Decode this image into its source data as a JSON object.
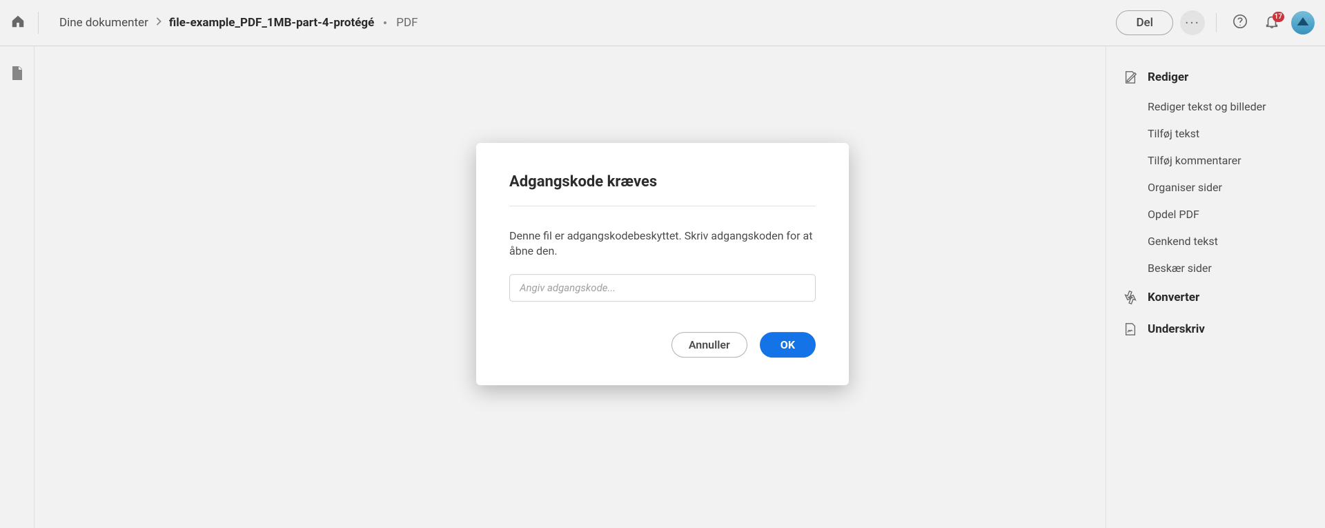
{
  "header": {
    "breadcrumb_root": "Dine dokumenter",
    "breadcrumb_file": "file-example_PDF_1MB-part-4-protégé",
    "file_type": "PDF",
    "share_label": "Del",
    "notification_count": "17"
  },
  "right_panel": {
    "edit": {
      "title": "Rediger",
      "items": [
        "Rediger tekst og billeder",
        "Tilføj tekst",
        "Tilføj kommentarer",
        "Organiser sider",
        "Opdel PDF",
        "Genkend tekst",
        "Beskær sider"
      ]
    },
    "convert": {
      "title": "Konverter"
    },
    "sign": {
      "title": "Underskriv"
    }
  },
  "modal": {
    "title": "Adgangskode kræves",
    "message": "Denne fil er adgangskodebeskyttet. Skriv adgangskoden for at åbne den.",
    "placeholder": "Angiv adgangskode...",
    "cancel_label": "Annuller",
    "ok_label": "OK"
  }
}
